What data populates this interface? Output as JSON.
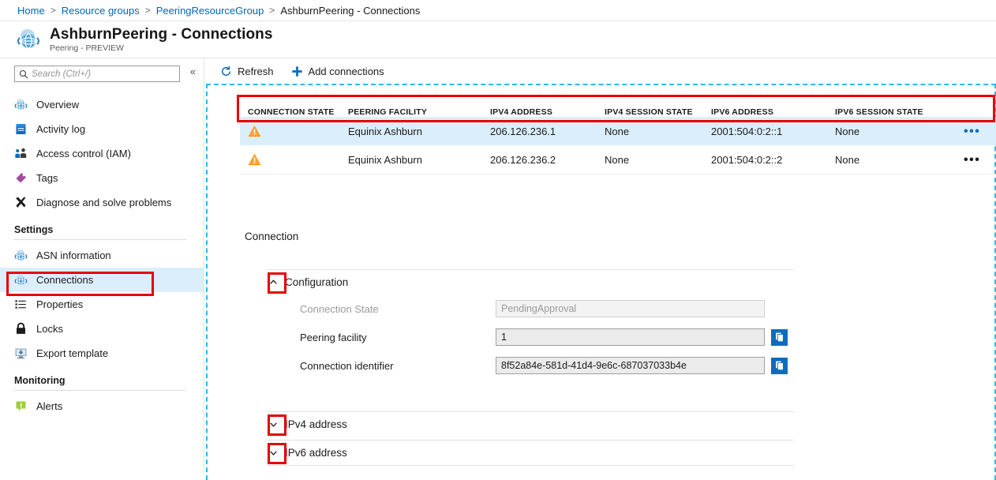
{
  "breadcrumb": {
    "items": [
      {
        "label": "Home",
        "link": true
      },
      {
        "label": "Resource groups",
        "link": true
      },
      {
        "label": "PeeringResourceGroup",
        "link": true
      },
      {
        "label": "AshburnPeering - Connections",
        "link": false
      }
    ],
    "separator": ">"
  },
  "header": {
    "title": "AshburnPeering  - Connections",
    "subtitle": "Peering - PREVIEW",
    "icon": "peering-globe-icon"
  },
  "sidebar": {
    "search": {
      "placeholder": "Search (Ctrl+/)",
      "value": "",
      "icon": "search-icon"
    },
    "collapse_icon": "«",
    "items": [
      {
        "label": "Overview",
        "icon": "peering-globe-icon",
        "selected": false
      },
      {
        "label": "Activity log",
        "icon": "activity-log-icon",
        "selected": false
      },
      {
        "label": "Access control (IAM)",
        "icon": "access-control-icon",
        "selected": false
      },
      {
        "label": "Tags",
        "icon": "tag-icon",
        "selected": false
      },
      {
        "label": "Diagnose and solve problems",
        "icon": "wrench-icon",
        "selected": false
      }
    ],
    "groups": [
      {
        "title": "Settings",
        "items": [
          {
            "label": "ASN information",
            "icon": "peering-globe-icon",
            "selected": false
          },
          {
            "label": "Connections",
            "icon": "peering-globe-icon",
            "selected": true
          },
          {
            "label": "Properties",
            "icon": "properties-icon",
            "selected": false
          },
          {
            "label": "Locks",
            "icon": "lock-icon",
            "selected": false
          },
          {
            "label": "Export template",
            "icon": "export-template-icon",
            "selected": false
          }
        ]
      },
      {
        "title": "Monitoring",
        "items": [
          {
            "label": "Alerts",
            "icon": "alerts-icon",
            "selected": false
          }
        ]
      }
    ]
  },
  "toolbar": {
    "refresh_label": "Refresh",
    "refresh_icon": "refresh-icon",
    "add_label": "Add connections",
    "add_icon": "plus-icon"
  },
  "table": {
    "columns": [
      "CONNECTION STATE",
      "PEERING FACILITY",
      "IPV4 ADDRESS",
      "IPV4 SESSION STATE",
      "IPV6 ADDRESS",
      "IPV6 SESSION STATE"
    ],
    "rows": [
      {
        "state_icon": "warning-icon",
        "peering_facility": "Equinix Ashburn",
        "ipv4_address": "206.126.236.1",
        "ipv4_session_state": "None",
        "ipv6_address": "2001:504:0:2::1",
        "ipv6_session_state": "None",
        "menu": "•••",
        "selected": true
      },
      {
        "state_icon": "warning-icon",
        "peering_facility": "Equinix Ashburn",
        "ipv4_address": "206.126.236.2",
        "ipv4_session_state": "None",
        "ipv6_address": "2001:504:0:2::2",
        "ipv6_session_state": "None",
        "menu": "•••",
        "selected": false
      }
    ]
  },
  "detail": {
    "title": "Connection",
    "sections": [
      {
        "label": "Configuration",
        "expanded": true,
        "chevron": "⌃",
        "fields": [
          {
            "label": "Connection State",
            "value": "PendingApproval",
            "disabled": true,
            "copy": false
          },
          {
            "label": "Peering facility",
            "value": "1",
            "disabled": false,
            "copy": true,
            "copy_icon": "copy-icon"
          },
          {
            "label": "Connection identifier",
            "value": "8f52a84e-581d-41d4-9e6c-687037033b4e",
            "disabled": false,
            "copy": true,
            "copy_icon": "copy-icon"
          }
        ]
      },
      {
        "label": "IPv4 address",
        "expanded": false,
        "chevron": "⌄",
        "fields": []
      },
      {
        "label": "IPv6 address",
        "expanded": false,
        "chevron": "⌄",
        "fields": []
      }
    ]
  },
  "colors": {
    "accent": "#0067b8",
    "selected_row": "#dbeefc",
    "annotation": "#e60000",
    "warning": "#ff8c00",
    "dashed_region": "#2fb7f0"
  }
}
